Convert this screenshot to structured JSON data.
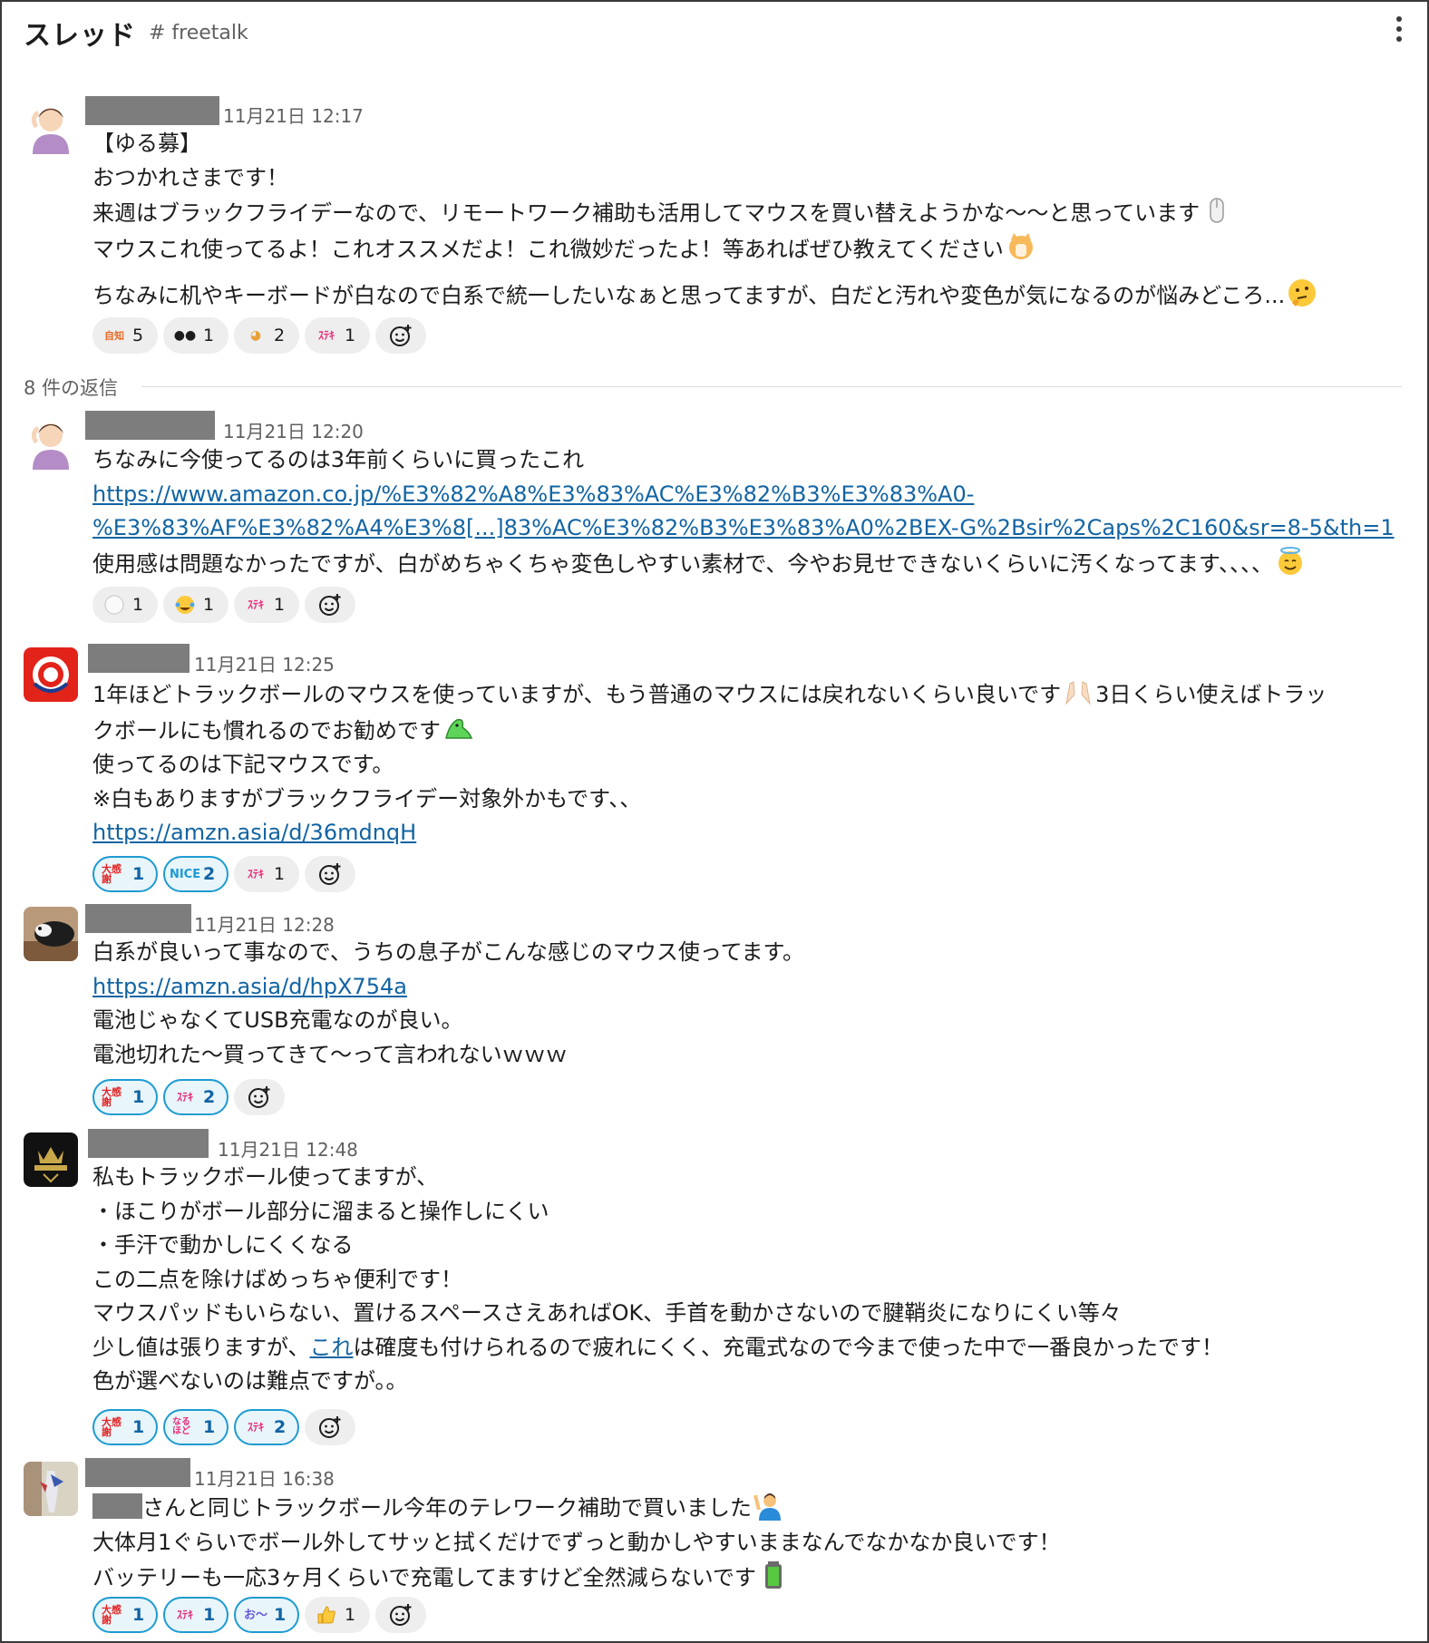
{
  "header": {
    "title": "スレッド",
    "channel": "# freetalk"
  },
  "divider": {
    "replies": "8 件の返信"
  },
  "messages": [
    {
      "time": "11月21日 12:17",
      "lines": [
        "【ゆる募】",
        "おつかれさまです！",
        "来週はブラックフライデーなので、リモートワーク補助も活用してマウスを買い替えようかな〜〜と思っています",
        "マウスこれ使ってるよ！これオススメだよ！これ微妙だったよ！等あればぜひ教えてください",
        "ちなみに机やキーボードが白なので白系で統一したいなぁと思ってますが、白だと汚れや変色が気になるのが悩みどころ..."
      ],
      "reactions": [
        {
          "icon": "shiritai-emoji",
          "label": "自分も知りたい",
          "count": "5"
        },
        {
          "icon": "eyes-emoji",
          "label": "👀",
          "count": "1"
        },
        {
          "icon": "cat-emoji",
          "label": "🐱",
          "count": "2"
        },
        {
          "icon": "suteki-emoji",
          "label": "ｽﾃｷ!!",
          "count": "1"
        }
      ]
    },
    {
      "time": "11月21日 12:20",
      "lines": [
        "ちなみに今使ってるのは3年前くらいに買ったこれ",
        "https://www.amazon.co.jp/%E3%82%A8%E3%83%AC%E3%82%B3%E3%83%A0-",
        "%E3%83%AF%E3%82%A4%E3%8[...]83%AC%E3%82%B3%E3%83%A0%2BEX-G%2Bsir%2Caps%2C160&sr=8-5&th=1",
        "使用感は問題なかったですが、白がめちゃくちゃ変色しやすい素材で、今やお見せできないくらいに汚くなってます、、、、"
      ],
      "reactions": [
        {
          "icon": "white-circle-emoji",
          "label": "⚪",
          "count": "1"
        },
        {
          "icon": "joy-emoji",
          "label": "😂",
          "count": "1"
        },
        {
          "icon": "suteki-emoji",
          "label": "ｽﾃｷ!!",
          "count": "1"
        }
      ]
    },
    {
      "time": "11月21日 12:25",
      "lines": [
        "1年ほどトラックボールのマウスを使っていますが、もう普通のマウスには戻れないくらい良いです",
        "3日くらい使えばトラッ",
        "クボールにも慣れるのでお勧めです",
        "使ってるのは下記マウスです。",
        "※白もありますがブラックフライデー対象外かもです、、",
        "https://amzn.asia/d/36mdnqH"
      ],
      "reactions": [
        {
          "icon": "daikansha-emoji",
          "label": "大感謝",
          "count": "1",
          "on": true
        },
        {
          "icon": "nice-emoji",
          "label": "NICE",
          "count": "2",
          "on": true
        },
        {
          "icon": "suteki-emoji",
          "label": "ｽﾃｷ!!",
          "count": "1"
        }
      ]
    },
    {
      "time": "11月21日 12:28",
      "lines": [
        "白系が良いって事なので、うちの息子がこんな感じのマウス使ってます。",
        "https://amzn.asia/d/hpX754a",
        "電池じゃなくてUSB充電なのが良い。",
        "電池切れた〜買ってきて〜って言われないｗｗｗ"
      ],
      "reactions": [
        {
          "icon": "daikansha-emoji",
          "label": "大感謝",
          "count": "1",
          "on": true
        },
        {
          "icon": "suteki-emoji",
          "label": "ｽﾃｷ!!",
          "count": "2",
          "on": true
        }
      ]
    },
    {
      "time": "11月21日 12:48",
      "lines": [
        "私もトラックボール使ってますが、",
        "・ほこりがボール部分に溜まると操作しにくい",
        "・手汗で動かしにくくなる",
        "この二点を除けばめっちゃ便利です！",
        "マウスパッドもいらない、置けるスペースさえあればOK、手首を動かさないので腱鞘炎になりにくい等々",
        "少し値は張りますが、",
        "これ",
        "は確度も付けられるので疲れにくく、充電式なので今まで使った中で一番良かったです！",
        "色が選べないのは難点ですが。。"
      ],
      "reactions": [
        {
          "icon": "daikansha-emoji",
          "label": "大感謝",
          "count": "1",
          "on": true
        },
        {
          "icon": "naruhodo-emoji",
          "label": "なるほど",
          "count": "1",
          "on": true
        },
        {
          "icon": "suteki-emoji",
          "label": "ｽﾃｷ!!",
          "count": "2",
          "on": true
        }
      ]
    },
    {
      "time": "11月21日 16:38",
      "lines": [
        "さんと同じトラックボール今年のテレワーク補助で買いました",
        "大体月1ぐらいでボール外してサッと拭くだけでずっと動かしやすいままなんでなかなか良いです！",
        "バッテリーも一応3ヶ月くらいで充電してますけど全然減らないです"
      ],
      "reactions": [
        {
          "icon": "daikansha-emoji",
          "label": "大感謝",
          "count": "1",
          "on": true
        },
        {
          "icon": "suteki-emoji",
          "label": "ｽﾃｷ!!",
          "count": "1",
          "on": true
        },
        {
          "icon": "otsu-emoji",
          "label": "お〜",
          "count": "1",
          "on": true
        },
        {
          "icon": "thumbsup-emoji",
          "label": "👍",
          "count": "1"
        }
      ]
    }
  ],
  "colors": {
    "link": "#1264a3",
    "reaction_on_border": "#1d9bd1",
    "reaction_on_bg": "#e8f5fa",
    "reaction_bg": "#eeeeee",
    "muted": "#616061",
    "redaction": "#7d7d7d"
  }
}
